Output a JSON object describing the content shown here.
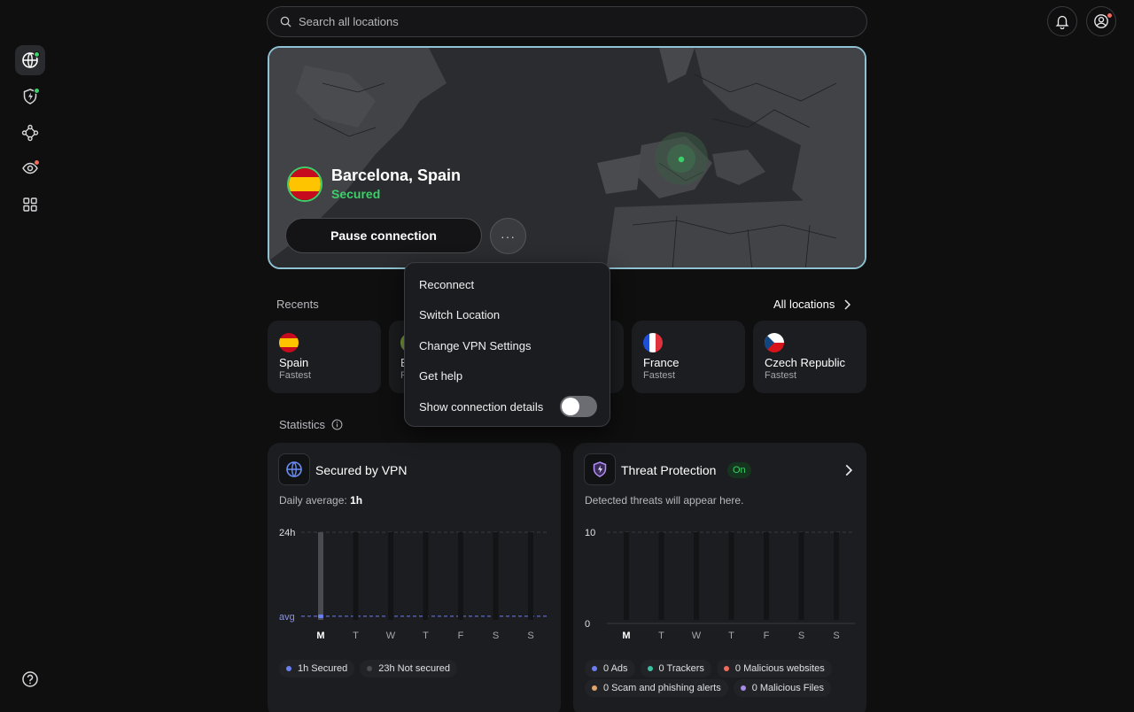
{
  "search": {
    "placeholder": "Search all locations"
  },
  "connection": {
    "location": "Barcelona, Spain",
    "status": "Secured",
    "pause_label": "Pause connection",
    "more_label": "···"
  },
  "menu": {
    "items": [
      "Reconnect",
      "Switch Location",
      "Change VPN Settings",
      "Get help",
      "Show connection details"
    ],
    "toggle_on": false
  },
  "recents": {
    "label": "Recents",
    "all_locations_label": "All locations",
    "items": [
      {
        "name": "Spain",
        "sub": "Fastest"
      },
      {
        "name": "E",
        "sub": "F"
      },
      {
        "name": "France",
        "sub": "Fastest"
      },
      {
        "name": "Czech Republic",
        "sub": "Fastest"
      }
    ]
  },
  "statistics": {
    "label": "Statistics"
  },
  "vpn_card": {
    "title": "Secured by VPN",
    "daily_label": "Daily average:",
    "daily_value": "1h",
    "y_top": "24h",
    "y_avg": "avg",
    "days": [
      "M",
      "T",
      "W",
      "T",
      "F",
      "S",
      "S"
    ],
    "legend": [
      {
        "label": "1h Secured",
        "color": "#6b7ef0"
      },
      {
        "label": "23h Not secured",
        "color": "#4a4b4f"
      }
    ]
  },
  "threat_card": {
    "title": "Threat Protection",
    "badge": "On",
    "subtitle": "Detected threats will appear here.",
    "y_top": "10",
    "y_bottom": "0",
    "days": [
      "M",
      "T",
      "W",
      "T",
      "F",
      "S",
      "S"
    ],
    "legend": [
      {
        "label": "0 Ads",
        "color": "#6b7ef0"
      },
      {
        "label": "0 Trackers",
        "color": "#3bbfa0"
      },
      {
        "label": "0 Malicious websites",
        "color": "#f26a5a"
      },
      {
        "label": "0 Scam and phishing alerts",
        "color": "#e0a36a"
      },
      {
        "label": "0 Malicious Files",
        "color": "#a78be8"
      }
    ]
  },
  "chart_data": [
    {
      "type": "bar",
      "categories": [
        "M",
        "T",
        "W",
        "T",
        "F",
        "S",
        "S"
      ],
      "series": [
        {
          "name": "Secured",
          "values": [
            1,
            0,
            0,
            0,
            0,
            0,
            0
          ]
        }
      ],
      "ylim": [
        0,
        24
      ],
      "y_ticks": [
        "24h",
        "avg"
      ],
      "average": 1
    },
    {
      "type": "bar",
      "categories": [
        "M",
        "T",
        "W",
        "T",
        "F",
        "S",
        "S"
      ],
      "series": [
        {
          "values": [
            0,
            0,
            0,
            0,
            0,
            0,
            0
          ]
        }
      ],
      "ylim": [
        0,
        10
      ],
      "y_ticks": [
        "10",
        "0"
      ]
    }
  ],
  "colors": {
    "accent_green": "#3ccf6a",
    "hero_border": "#8fc3d3",
    "avg_line": "#6b7ef0"
  }
}
